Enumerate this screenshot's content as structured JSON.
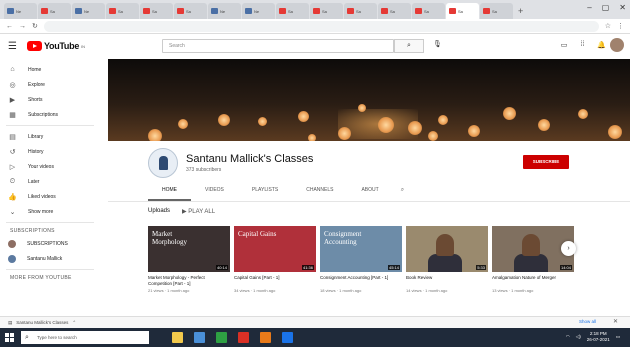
{
  "browser": {
    "tabs": [
      {
        "title": "Ne",
        "color": "#4a6fa5"
      },
      {
        "title": "Sa",
        "color": "#e53935"
      },
      {
        "title": "Ne",
        "color": "#4a6fa5"
      },
      {
        "title": "Sa",
        "color": "#e53935"
      },
      {
        "title": "Sa",
        "color": "#e53935"
      },
      {
        "title": "Sa",
        "color": "#e53935"
      },
      {
        "title": "Ne",
        "color": "#4a6fa5"
      },
      {
        "title": "Ne",
        "color": "#4a6fa5"
      },
      {
        "title": "Sa",
        "color": "#e53935"
      },
      {
        "title": "Sa",
        "color": "#e53935"
      },
      {
        "title": "Sa",
        "color": "#e53935"
      },
      {
        "title": "Sa",
        "color": "#e53935"
      },
      {
        "title": "Sa",
        "color": "#e53935"
      },
      {
        "title": "Sa",
        "color": "#e53935"
      },
      {
        "title": "Sa",
        "color": "#e53935"
      }
    ],
    "new_tab": "+"
  },
  "header": {
    "logo_text": "YouTube",
    "logo_sup": "IN",
    "search_placeholder": "Search"
  },
  "sidebar": {
    "items": [
      {
        "label": "Home",
        "icon": "⌂"
      },
      {
        "label": "Explore",
        "icon": "◎"
      },
      {
        "label": "Shorts",
        "icon": "▶"
      },
      {
        "label": "Subscriptions",
        "icon": "▦"
      },
      {
        "label": "Library",
        "icon": "▤"
      },
      {
        "label": "History",
        "icon": "↺"
      },
      {
        "label": "Your videos",
        "icon": "▷"
      },
      {
        "label": "Later",
        "icon": "⏲"
      },
      {
        "label": "Liked videos",
        "icon": "👍"
      },
      {
        "label": "Show more",
        "icon": "⌄"
      }
    ],
    "subscriptions_heading": "SUBSCRIPTIONS",
    "subscriptions": [
      {
        "label": "SUBSCRIPTIONS",
        "color": "#8d6e63"
      },
      {
        "label": "Santanu Mallick",
        "color": "#5c7aa0"
      }
    ],
    "more_heading": "MORE FROM YOUTUBE"
  },
  "channel": {
    "name": "Santanu Mallick's Classes",
    "subscribers": "373 subscribers",
    "subscribe_label": "SUBSCRIBE",
    "tabs": [
      "HOME",
      "VIDEOS",
      "PLAYLISTS",
      "CHANNELS",
      "ABOUT"
    ],
    "active_tab": 0
  },
  "uploads": {
    "heading": "Uploads",
    "play_all": "▶ PLAY ALL"
  },
  "videos": [
    {
      "thumb_text": "Market Morphology",
      "title": "Market Morphology - Perfect Competition [Part - 1]",
      "meta": "21 views · 1 month ago",
      "duration": "40:14",
      "bg": "#3a3030"
    },
    {
      "thumb_text": "Capital Gains",
      "title": "Capital Gains [Part - 1]",
      "meta": "34 views · 1 month ago",
      "duration": "41:36",
      "bg": "#b0303a"
    },
    {
      "thumb_text": "Consignment Accounting",
      "title": "Consignment Accounting [Part - 1]",
      "meta": "18 views · 1 month ago",
      "duration": "45:14",
      "bg": "#6d8ca8"
    },
    {
      "thumb_text": "",
      "title": "Book Review",
      "meta": "14 views · 1 month ago",
      "duration": "5:33",
      "bg": "#9a8a6e"
    },
    {
      "thumb_text": "",
      "title": "Amalgamation Nature of Merger",
      "meta": "13 views · 1 month ago",
      "duration": "14:04",
      "bg": "#807060"
    }
  ],
  "downloads": {
    "file": "Santanu Mallick's Classes",
    "show_all": "Show all"
  },
  "taskbar": {
    "search_placeholder": "Type here to search",
    "time": "2:18 PM",
    "date": "26-07-2021",
    "apps": [
      {
        "color": "#f2c94c"
      },
      {
        "color": "#4a90d9"
      },
      {
        "color": "#2ea043"
      },
      {
        "color": "#d93025"
      },
      {
        "color": "#e87a1a"
      },
      {
        "color": "#1a73e8"
      }
    ]
  }
}
